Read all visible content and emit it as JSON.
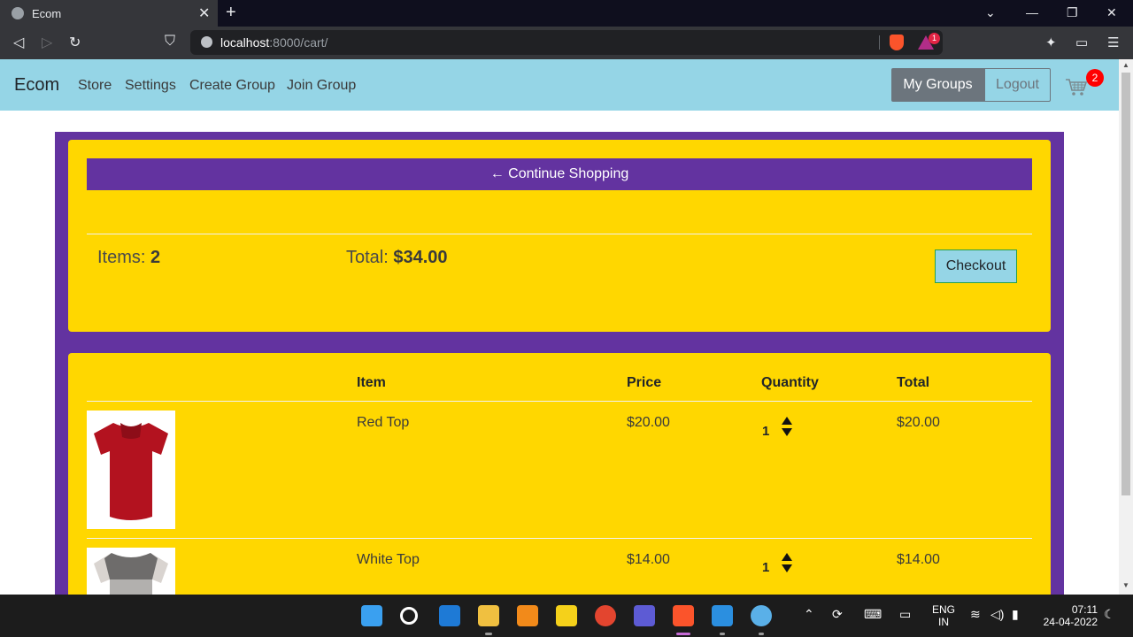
{
  "browser": {
    "tab_title": "Ecom",
    "tab_close": "✕",
    "new_tab": "+",
    "url_host": "localhost",
    "url_path": ":8000/cart/",
    "rewards_badge": "1"
  },
  "navbar": {
    "brand": "Ecom",
    "links": [
      "Store",
      "Settings",
      "Create Group",
      "Join Group"
    ],
    "my_groups": "My Groups",
    "logout": "Logout",
    "cart_count": "2"
  },
  "summary": {
    "continue": "← Continue Shopping",
    "items_label": "Items:",
    "items_value": "2",
    "total_label": "Total:",
    "total_value": "$34.00",
    "checkout": "Checkout"
  },
  "table": {
    "headers": [
      "Item",
      "Price",
      "Quantity",
      "Total"
    ],
    "rows": [
      {
        "name": "Red Top",
        "price": "$20.00",
        "qty": "1",
        "total": "$20.00"
      },
      {
        "name": "White Top",
        "price": "$14.00",
        "qty": "1",
        "total": "$14.00"
      }
    ]
  },
  "taskbar": {
    "lang_top": "ENG",
    "lang_bottom": "IN",
    "time": "07:11",
    "date": "24-04-2022"
  },
  "colors": {
    "navbar": "#95d5e6",
    "purple": "#6333a0",
    "yellow": "#ffd700"
  }
}
